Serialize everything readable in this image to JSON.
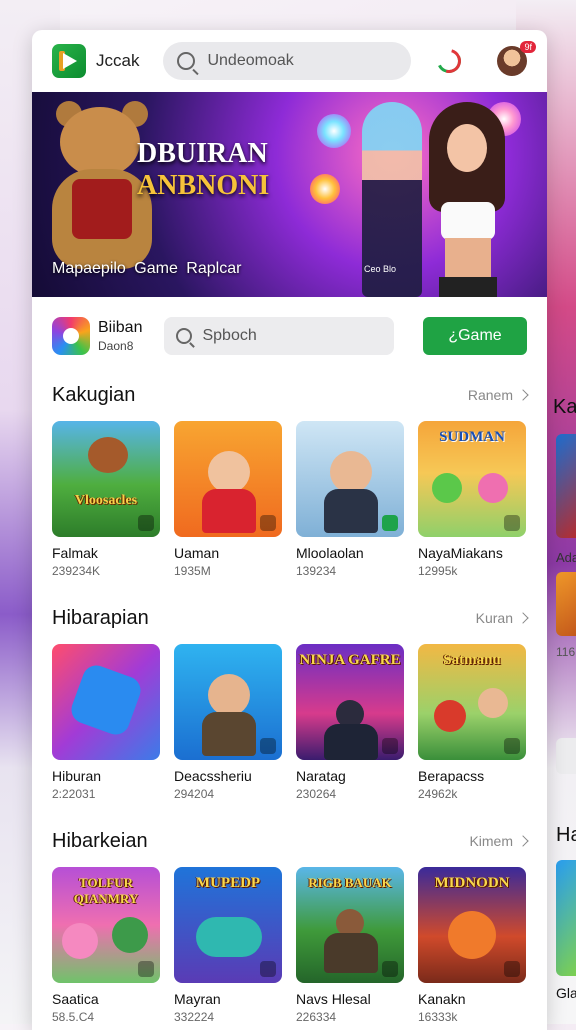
{
  "header": {
    "app_name": "Jccak",
    "search_placeholder": "Undeomoak",
    "avatar_badge": "9f"
  },
  "hero": {
    "title_line1": "DBUIRAN",
    "title_line2": "ANBNONI",
    "subtitle": "Mapaepilo Game Raplcar",
    "small_text": "Ceo Blo"
  },
  "subbar": {
    "name": "Biiban",
    "sub": "Daon8",
    "search_placeholder": "Spboch",
    "game_button": "¿Game"
  },
  "sections": [
    {
      "title": "Kakugian",
      "more": "Ranem",
      "items": [
        {
          "label": "Vloosacles",
          "name": "Falmak",
          "count": "239234K"
        },
        {
          "label": "",
          "name": "Uaman",
          "count": "1935M"
        },
        {
          "label": "",
          "name": "Mloolaolan",
          "count": "139234"
        },
        {
          "label": "SUDMAN",
          "name": "NayaMiakans",
          "count": "12995k"
        }
      ]
    },
    {
      "title": "Hibarapian",
      "more": "Kuran",
      "items": [
        {
          "label": "",
          "name": "Hiburan",
          "count": "2:22031"
        },
        {
          "label": "",
          "name": "Deacssheriu",
          "count": "294204"
        },
        {
          "label": "NINJA GAFRE",
          "name": "Naratag",
          "count": "230264"
        },
        {
          "label": "Satmanu",
          "name": "Berapacss",
          "count": "24962k"
        }
      ]
    },
    {
      "title": "Hibarkeian",
      "more": "Kimem",
      "items": [
        {
          "label": "TOLFUR QIANMRY",
          "name": "Saatica",
          "count": "58.5.C4"
        },
        {
          "label": "MUPEDP",
          "name": "Mayran",
          "count": "332224"
        },
        {
          "label": "RIGB BAUAK",
          "name": "Navs Hlesal",
          "count": "226334"
        },
        {
          "label": "MIDNODN",
          "name": "Kanakn",
          "count": "16333k"
        }
      ]
    }
  ],
  "side_peek": {
    "title1": "Ka",
    "text1": "Ada",
    "count1": "116",
    "title2": "Ha",
    "text2": "Gla"
  }
}
